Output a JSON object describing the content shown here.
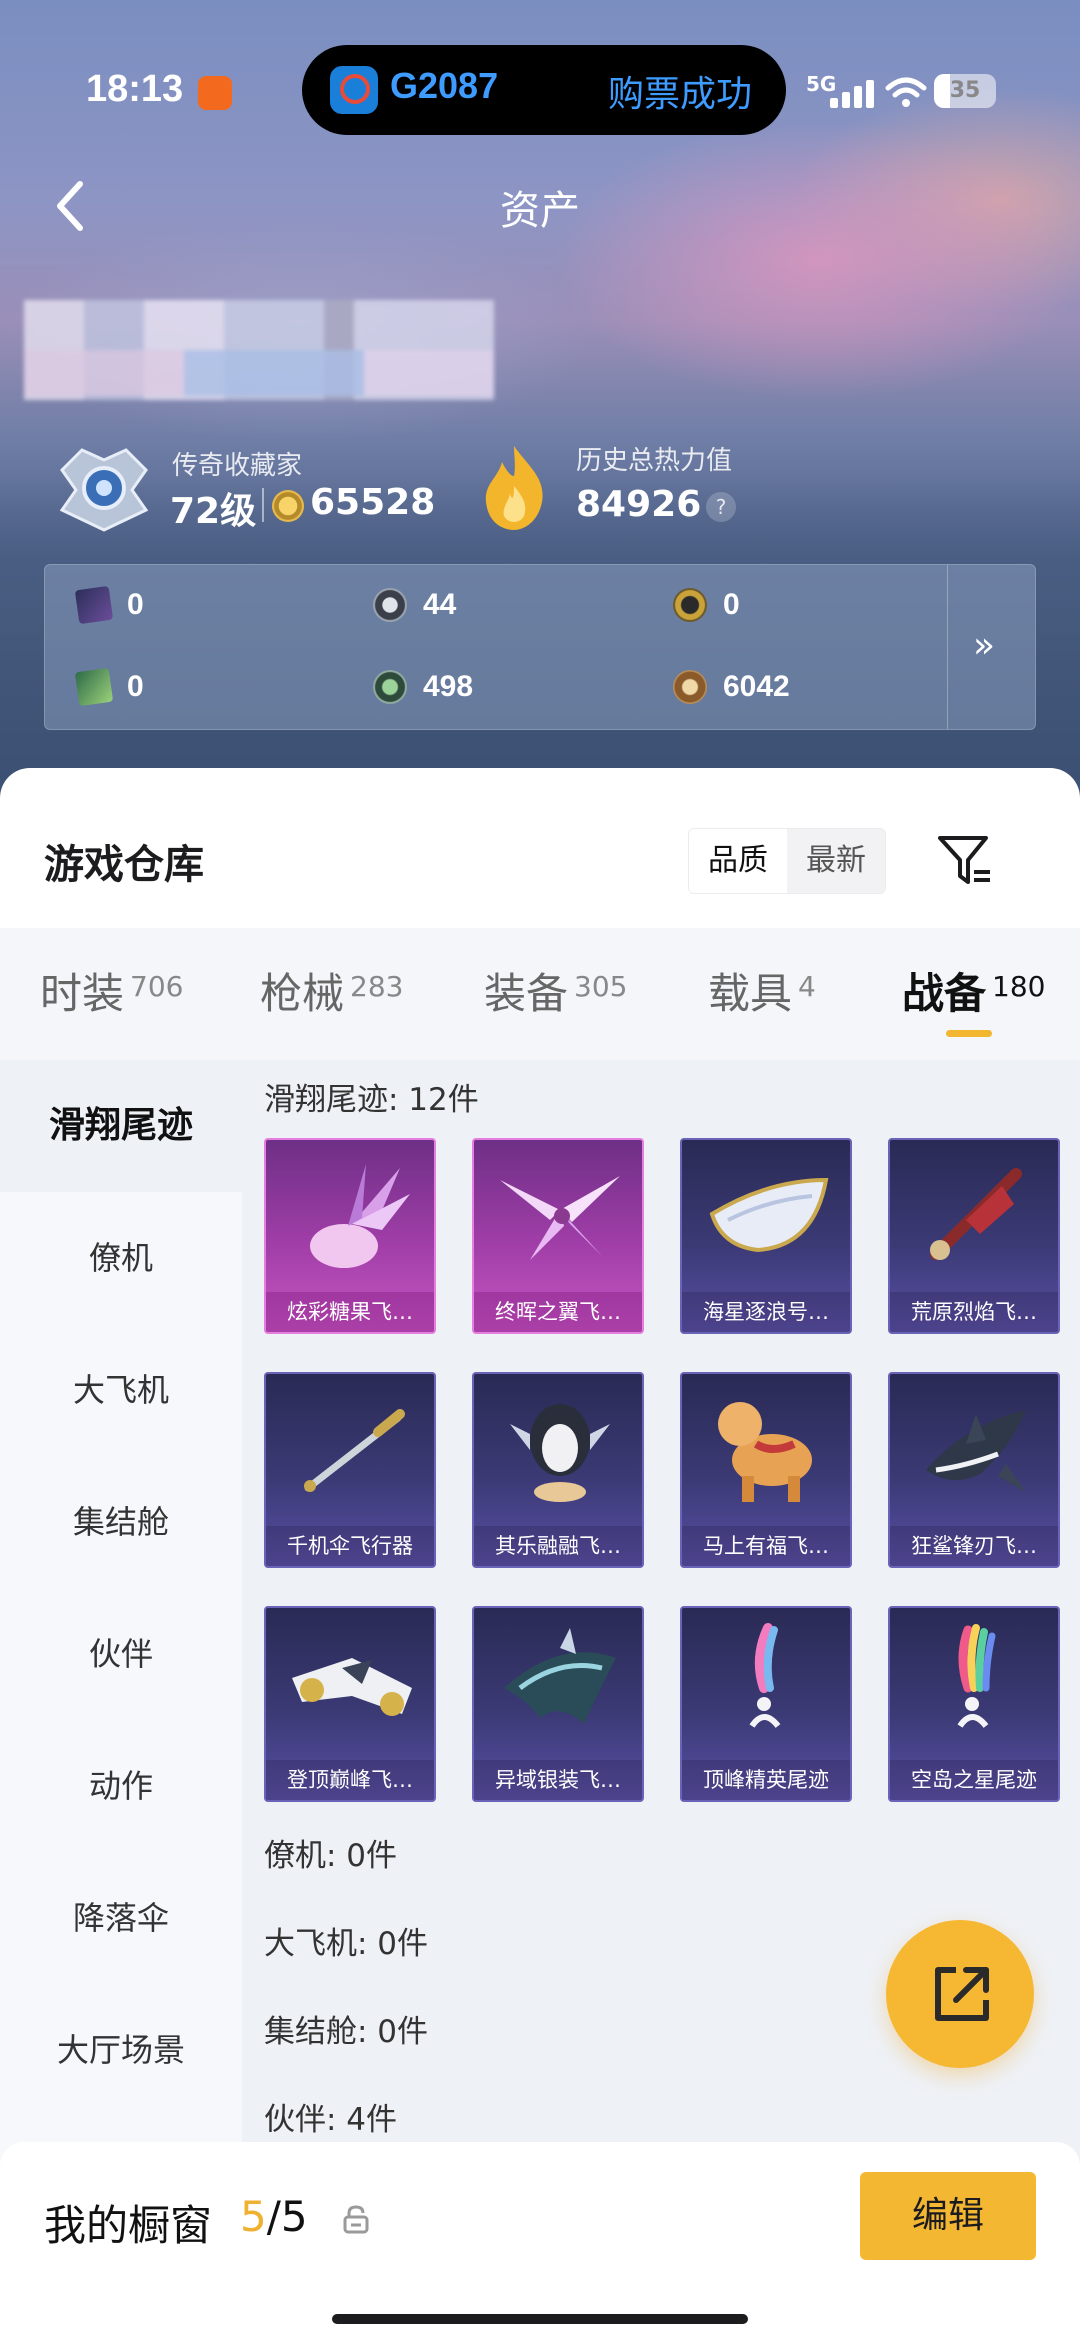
{
  "status_bar": {
    "time": "18:13",
    "network": "5G",
    "battery": "35"
  },
  "live_activity": {
    "train_number": "G2087",
    "status": "购票成功"
  },
  "nav": {
    "title": "资产"
  },
  "profile": {
    "rank_title": "传奇收藏家",
    "level": "72级",
    "coins": "65528",
    "heat_title": "历史总热力值",
    "heat_value": "84926",
    "help": "?"
  },
  "assets": [
    {
      "icon": "dark-card-icon",
      "value": "0"
    },
    {
      "icon": "silver-coin-icon",
      "value": "44"
    },
    {
      "icon": "gold-ring-coin-icon",
      "value": "0"
    },
    {
      "icon": "green-card-icon",
      "value": "0"
    },
    {
      "icon": "green-coin-icon",
      "value": "498"
    },
    {
      "icon": "bronze-coin-icon",
      "value": "6042"
    }
  ],
  "warehouse": {
    "title": "游戏仓库",
    "sort": [
      "品质",
      "最新"
    ]
  },
  "tabs": [
    {
      "label": "时装",
      "count": "706"
    },
    {
      "label": "枪械",
      "count": "283"
    },
    {
      "label": "装备",
      "count": "305"
    },
    {
      "label": "载具",
      "count": "4"
    },
    {
      "label": "战备",
      "count": "180"
    }
  ],
  "sidebar": [
    "滑翔尾迹",
    "僚机",
    "大飞机",
    "集结舱",
    "伙伴",
    "动作",
    "降落伞",
    "大厅场景"
  ],
  "sections": [
    "滑翔尾迹: 12件",
    "僚机: 0件",
    "大飞机: 0件",
    "集结舱: 0件",
    "伙伴: 4件"
  ],
  "items": [
    {
      "name": "炫彩糖果飞…",
      "rarity": "purple"
    },
    {
      "name": "终晖之翼飞…",
      "rarity": "purple"
    },
    {
      "name": "海星逐浪号…",
      "rarity": "blue"
    },
    {
      "name": "荒原烈焰飞…",
      "rarity": "blue"
    },
    {
      "name": "千机伞飞行器",
      "rarity": "blue"
    },
    {
      "name": "其乐融融飞…",
      "rarity": "blue"
    },
    {
      "name": "马上有福飞…",
      "rarity": "blue"
    },
    {
      "name": "狂鲨锋刃飞…",
      "rarity": "blue"
    },
    {
      "name": "登顶巅峰飞…",
      "rarity": "blue"
    },
    {
      "name": "异域银装飞…",
      "rarity": "blue"
    },
    {
      "name": "顶峰精英尾迹",
      "rarity": "blue"
    },
    {
      "name": "空岛之星尾迹",
      "rarity": "blue"
    }
  ],
  "showcase": {
    "title": "我的橱窗",
    "current": "5",
    "total": "/5",
    "edit": "编辑"
  },
  "colors": {
    "accent": "#f4b731",
    "purple_rarity": "#a13ea8",
    "blue_rarity": "#3b3a75"
  }
}
